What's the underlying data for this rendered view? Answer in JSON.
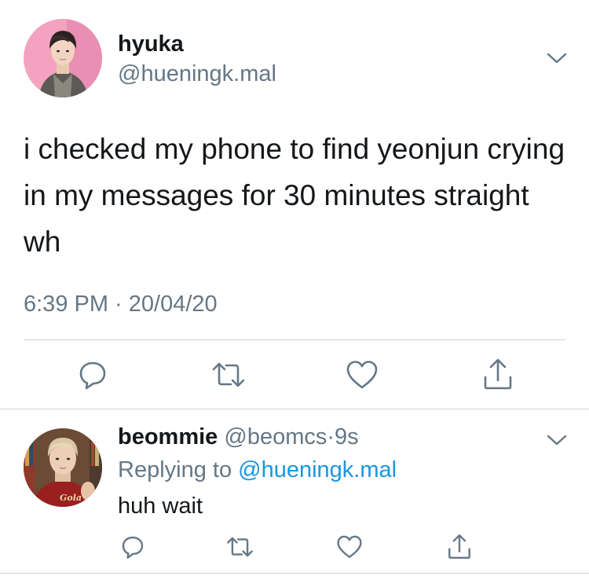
{
  "tweet": {
    "display_name": "hyuka",
    "handle": "@hueningk.mal",
    "text": "i checked my phone to find yeonjun crying in my messages for 30 minutes straight wh",
    "timestamp": "6:39 PM · 20/04/20",
    "actions": [
      "reply-icon",
      "retweet-icon",
      "like-icon",
      "share-icon"
    ]
  },
  "reply": {
    "display_name": "beommie",
    "handle": "@beomcs",
    "separator": "·",
    "time_ago": "9s",
    "replying_prefix": "Replying to",
    "replying_to": "@hueningk.mal",
    "text": "huh wait",
    "avatar_badge": "Gola",
    "actions": [
      "reply-icon",
      "retweet-icon",
      "like-icon",
      "share-icon"
    ]
  },
  "colors": {
    "text_primary": "#14171a",
    "text_secondary": "#657786",
    "link": "#1b95e0",
    "divider": "#ccd6dd",
    "icon": "#657786"
  }
}
